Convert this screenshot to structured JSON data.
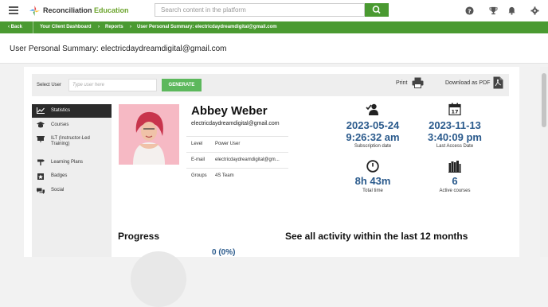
{
  "brand": {
    "name_part1": "Reconciliation",
    "name_part2": "Education"
  },
  "search": {
    "placeholder": "Search content in the platform"
  },
  "breadcrumb": {
    "back": "Back",
    "items": [
      "Your Client Dashboard",
      "Reports",
      "User Personal Summary: electricdaydreamdigital@gmail.com"
    ]
  },
  "page_title": "User Personal Summary: electricdaydreamdigital@gmail.com",
  "toolbar": {
    "select_user_label": "Select User",
    "select_user_placeholder": "Type user here",
    "generate_label": "GENERATE",
    "print_label": "Print",
    "download_label": "Download as PDF"
  },
  "menu": [
    {
      "label": "Statistics",
      "icon": "chart-icon",
      "active": true
    },
    {
      "label": "Courses",
      "icon": "hat-icon"
    },
    {
      "label": "ILT (Instructor-Led Training)",
      "icon": "presentation-icon"
    },
    {
      "label": "Learning Plans",
      "icon": "signpost-icon"
    },
    {
      "label": "Badges",
      "icon": "badge-icon"
    },
    {
      "label": "Social",
      "icon": "chat-icon"
    }
  ],
  "user": {
    "name": "Abbey Weber",
    "email": "electricdaydreamdigital@gmail.com",
    "rows": [
      {
        "key": "Level",
        "value": "Power User"
      },
      {
        "key": "E-mail",
        "value": "electricdaydreamdigital@gm..."
      },
      {
        "key": "Groups",
        "value": "4S Team"
      }
    ]
  },
  "stats": {
    "subscription": {
      "date": "2023-05-24",
      "time": "9:26:32 am",
      "label": "Subscription date",
      "icon": "user-check-icon"
    },
    "last_access": {
      "date": "2023-11-13",
      "time": "3:40:09 pm",
      "label": "Last Access Date",
      "icon": "calendar-icon",
      "calendar_day": "17"
    },
    "total_time": {
      "value": "8h 43m",
      "label": "Total time",
      "icon": "clock-icon"
    },
    "active_courses": {
      "value": "6",
      "label": "Active courses",
      "icon": "books-icon"
    }
  },
  "sections": {
    "progress_title": "Progress",
    "progress_value": "0 (0%)",
    "activity_title": "See all activity within the last 12 months"
  },
  "colors": {
    "accent": "#4a9a31",
    "stat_blue": "#2a5a8c",
    "menu_active": "#2b2b2b"
  }
}
